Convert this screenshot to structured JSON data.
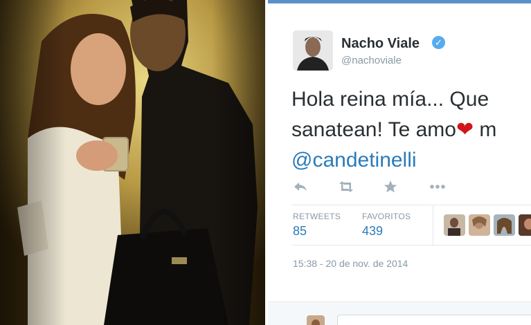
{
  "tweet": {
    "display_name": "Nacho Viale",
    "handle": "@nachoviale",
    "text_line1": "Hola reina mía... Que",
    "text_line2_a": "sanatean! Te amo",
    "text_line2_heart": "❤",
    "text_line2_b": " m",
    "mention": "@candetinelli",
    "timestamp": "15:38 - 20 de nov. de 2014"
  },
  "actions": {
    "reply_icon": "reply-icon",
    "retweet_icon": "retweet-icon",
    "favorite_icon": "star-icon",
    "more_icon": "more-icon"
  },
  "stats": {
    "retweets_label": "RETWEETS",
    "retweets_value": "85",
    "favorites_label": "FAVORITOS",
    "favorites_value": "439"
  },
  "colors": {
    "link": "#2b7bb9",
    "verified": "#55acee",
    "heart": "#d0161c",
    "muted": "#8899a6"
  }
}
